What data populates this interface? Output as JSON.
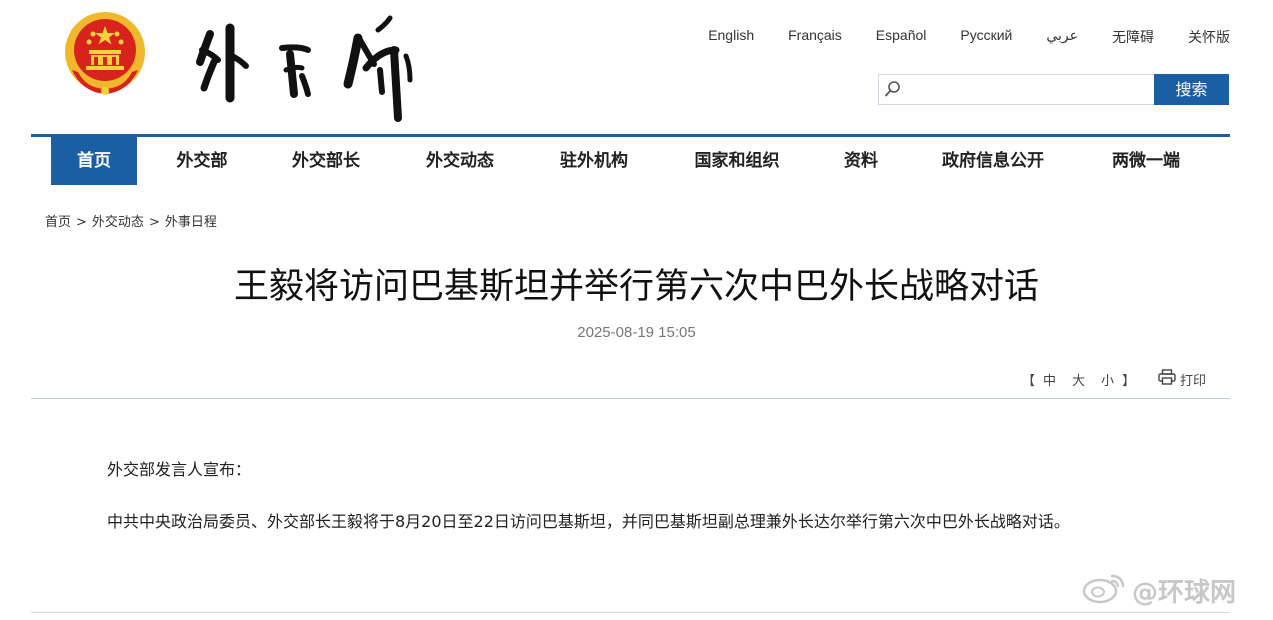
{
  "header": {
    "languages": [
      "English",
      "Français",
      "Español",
      "Русский",
      "عربي",
      "无障碍",
      "关怀版"
    ],
    "search": {
      "placeholder": "",
      "button_label": "搜索"
    }
  },
  "nav": {
    "items": [
      "首页",
      "外交部",
      "外交部长",
      "外交动态",
      "驻外机构",
      "国家和组织",
      "资料",
      "政府信息公开",
      "两微一端"
    ],
    "active_index": 0
  },
  "breadcrumb": [
    "首页",
    "外交动态",
    "外事日程"
  ],
  "breadcrumb_separator": ">",
  "article": {
    "title": "王毅将访问巴基斯坦并举行第六次中巴外长战略对话",
    "time": "2025-08-19 15:05",
    "font_size": {
      "open": "【",
      "large": "中",
      "medium": "大",
      "small": "小",
      "close": "】"
    },
    "print_label": "打印",
    "paragraphs": [
      "外交部发言人宣布：",
      "中共中央政治局委员、外交部长王毅将于8月20日至22日访问巴基斯坦，并同巴基斯坦副总理兼外长达尔举行第六次中巴外长战略对话。"
    ]
  },
  "watermark": {
    "text": "@环球网"
  },
  "colors": {
    "primary_blue": "#1a5fa4",
    "emblem_red": "#d8231c",
    "emblem_gold": "#f5c518"
  }
}
